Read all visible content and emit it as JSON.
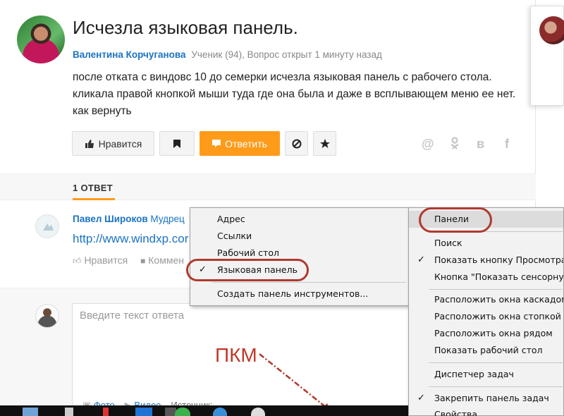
{
  "question": {
    "title": "Исчезла языковая панель.",
    "author": "Валентина Корчуганова",
    "meta": "Ученик (94), Вопрос открыт 1 минуту назад",
    "text": "после отката с виндовс 10 до семерки исчезла языковая панель с рабочего стола. кликала правой кнопкой мыши туда где она была и даже в всплывающем меню ее нет. как вернуть"
  },
  "actions": {
    "like_label": "Нравится",
    "answer_label": "Ответить"
  },
  "share_icons": [
    "@",
    "ok",
    "в",
    "f"
  ],
  "answers": {
    "count_label": "1 ОТВЕТ",
    "items": [
      {
        "author": "Павел Широков",
        "rank": "Мудрец",
        "link": "http://www.windxp.cor",
        "like_label": "Нравится",
        "comment_label": "Коммен"
      }
    ]
  },
  "reply": {
    "placeholder": "Введите текст ответа",
    "photo_label": "Фото",
    "video_label": "Видео",
    "source_label": "Источник:"
  },
  "annotation": {
    "pkm_label": "ПКМ"
  },
  "context_menu": {
    "main_items": [
      {
        "label": "Панели",
        "checked": false,
        "highlighted": true
      },
      {
        "label": "Поиск",
        "checked": false
      },
      {
        "label": "Показать кнопку Просмотра задач",
        "checked": true
      },
      {
        "label": "Кнопка \"Показать сенсорную клавиатуру\"",
        "checked": false
      },
      {
        "label": "Расположить окна каскадом",
        "checked": false
      },
      {
        "label": "Расположить окна стопкой",
        "checked": false
      },
      {
        "label": "Расположить окна рядом",
        "checked": false
      },
      {
        "label": "Показать рабочий стол",
        "checked": false
      },
      {
        "label": "Диспетчер задач",
        "checked": false
      },
      {
        "label": "Закрепить панель задач",
        "checked": true
      },
      {
        "label": "Свойства",
        "checked": false
      }
    ],
    "sub_items": [
      {
        "label": "Адрес",
        "checked": false
      },
      {
        "label": "Ссылки",
        "checked": false
      },
      {
        "label": "Рабочий стол",
        "checked": false
      },
      {
        "label": "Языковая панель",
        "checked": true
      },
      {
        "label": "Создать панель инструментов...",
        "checked": false
      }
    ]
  },
  "colors": {
    "accent": "#ff9b1a",
    "link": "#1a73c4",
    "annotation": "#b03a2e"
  }
}
